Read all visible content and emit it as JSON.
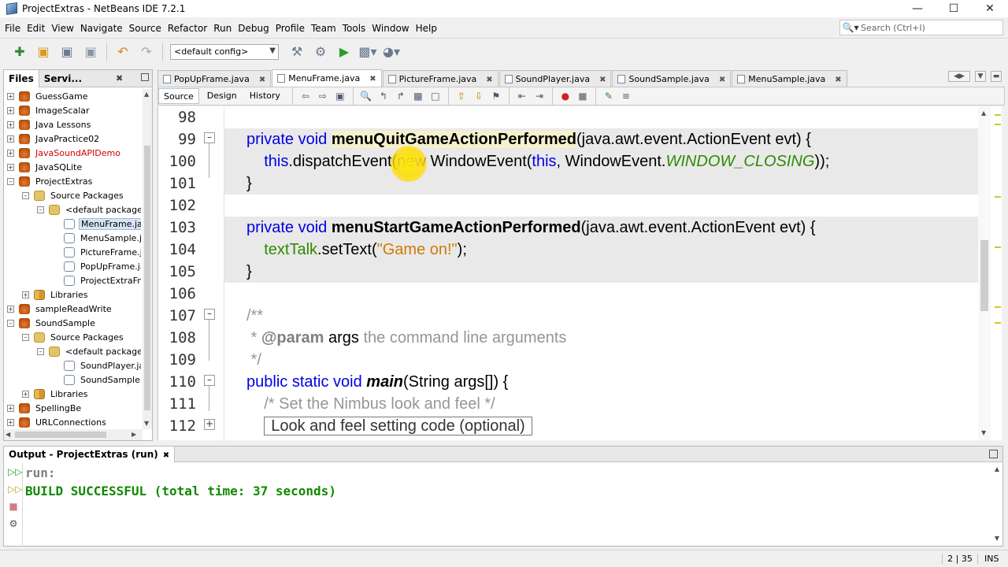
{
  "window": {
    "title": "ProjectExtras - NetBeans IDE 7.2.1"
  },
  "menu": [
    "File",
    "Edit",
    "View",
    "Navigate",
    "Source",
    "Refactor",
    "Run",
    "Debug",
    "Profile",
    "Team",
    "Tools",
    "Window",
    "Help"
  ],
  "search": {
    "placeholder": "Search (Ctrl+I)"
  },
  "toolbar": {
    "config": "<default config>"
  },
  "left_panel": {
    "tabs": [
      "Files",
      "Servi..."
    ],
    "tree": [
      {
        "label": "GuessGame",
        "type": "project",
        "expand": "+"
      },
      {
        "label": "ImageScalar",
        "type": "project",
        "expand": "+"
      },
      {
        "label": "Java Lessons",
        "type": "project",
        "expand": "+"
      },
      {
        "label": "JavaPractice02",
        "type": "project",
        "expand": "+"
      },
      {
        "label": "JavaSoundAPIDemo",
        "type": "project",
        "expand": "+",
        "error": true
      },
      {
        "label": "JavaSQLite",
        "type": "project",
        "expand": "+"
      },
      {
        "label": "ProjectExtras",
        "type": "project",
        "expand": "-"
      },
      {
        "label": "Source Packages",
        "type": "package",
        "expand": "-"
      },
      {
        "label": "<default package>",
        "type": "package",
        "expand": "-"
      },
      {
        "label": "MenuFrame.jav",
        "type": "file",
        "selected": true
      },
      {
        "label": "MenuSample.jav",
        "type": "file"
      },
      {
        "label": "PictureFrame.ja",
        "type": "file"
      },
      {
        "label": "PopUpFrame.ja",
        "type": "file"
      },
      {
        "label": "ProjectExtraFra",
        "type": "file"
      },
      {
        "label": "Libraries",
        "type": "library",
        "expand": "+"
      },
      {
        "label": "sampleReadWrite",
        "type": "project",
        "expand": "+"
      },
      {
        "label": "SoundSample",
        "type": "project",
        "expand": "-"
      },
      {
        "label": "Source Packages",
        "type": "package",
        "expand": "-"
      },
      {
        "label": "<default package>",
        "type": "package",
        "expand": "-"
      },
      {
        "label": "SoundPlayer.jav",
        "type": "file"
      },
      {
        "label": "SoundSample.ja",
        "type": "file"
      },
      {
        "label": "Libraries",
        "type": "library",
        "expand": "+"
      },
      {
        "label": "SpellingBe",
        "type": "project",
        "expand": "+"
      },
      {
        "label": "URLConnections",
        "type": "project",
        "expand": "+"
      }
    ]
  },
  "editor": {
    "tabs": [
      {
        "label": "PopUpFrame.java",
        "active": false
      },
      {
        "label": "MenuFrame.java",
        "active": true
      },
      {
        "label": "PictureFrame.java",
        "active": false
      },
      {
        "label": "SoundPlayer.java",
        "active": false
      },
      {
        "label": "SoundSample.java",
        "active": false
      },
      {
        "label": "MenuSample.java",
        "active": false
      }
    ],
    "views": [
      "Source",
      "Design",
      "History"
    ],
    "line_numbers": [
      "98",
      "99",
      "100",
      "101",
      "102",
      "103",
      "104",
      "105",
      "106",
      "107",
      "108",
      "109",
      "110",
      "111",
      "112"
    ],
    "code": {
      "l99": {
        "kw": "private void ",
        "method": "menuQuitGameActionPerformed",
        "rest": "(java.awt.event.ActionEvent evt) {"
      },
      "l100": {
        "this1": "this",
        "call": ".dispatchEvent(",
        "new": "new",
        "cls": " WindowEvent(",
        "this2": "this",
        "mid": ", WindowEvent.",
        "const": "WINDOW_CLOSING",
        "end": "));"
      },
      "l101": "}",
      "l103": {
        "kw": "private void ",
        "method": "menuStartGameActionPerformed",
        "rest": "(java.awt.event.ActionEvent evt) {"
      },
      "l104": {
        "field": "textTalk",
        "call": ".setText(",
        "str": "\"Game on!\"",
        "end": ");"
      },
      "l105": "}",
      "l107": "/**",
      "l108": {
        "star": " * ",
        "tag": "@param",
        "name": " args",
        "desc": " the command line arguments"
      },
      "l109": " */",
      "l110": {
        "kw": "public static void ",
        "method": "main",
        "rest": "(String args[]) {"
      },
      "l111": "/* Set the Nimbus look and feel */",
      "l112": "Look and feel setting code (optional)"
    }
  },
  "output": {
    "title": "Output - ProjectExtras (run)",
    "lines": [
      {
        "text": "run:",
        "color": "#808080"
      },
      {
        "text": "BUILD SUCCESSFUL (total time: 37 seconds)",
        "color": "#118800"
      }
    ]
  },
  "statusbar": {
    "position": "2 | 35",
    "mode": "INS"
  }
}
